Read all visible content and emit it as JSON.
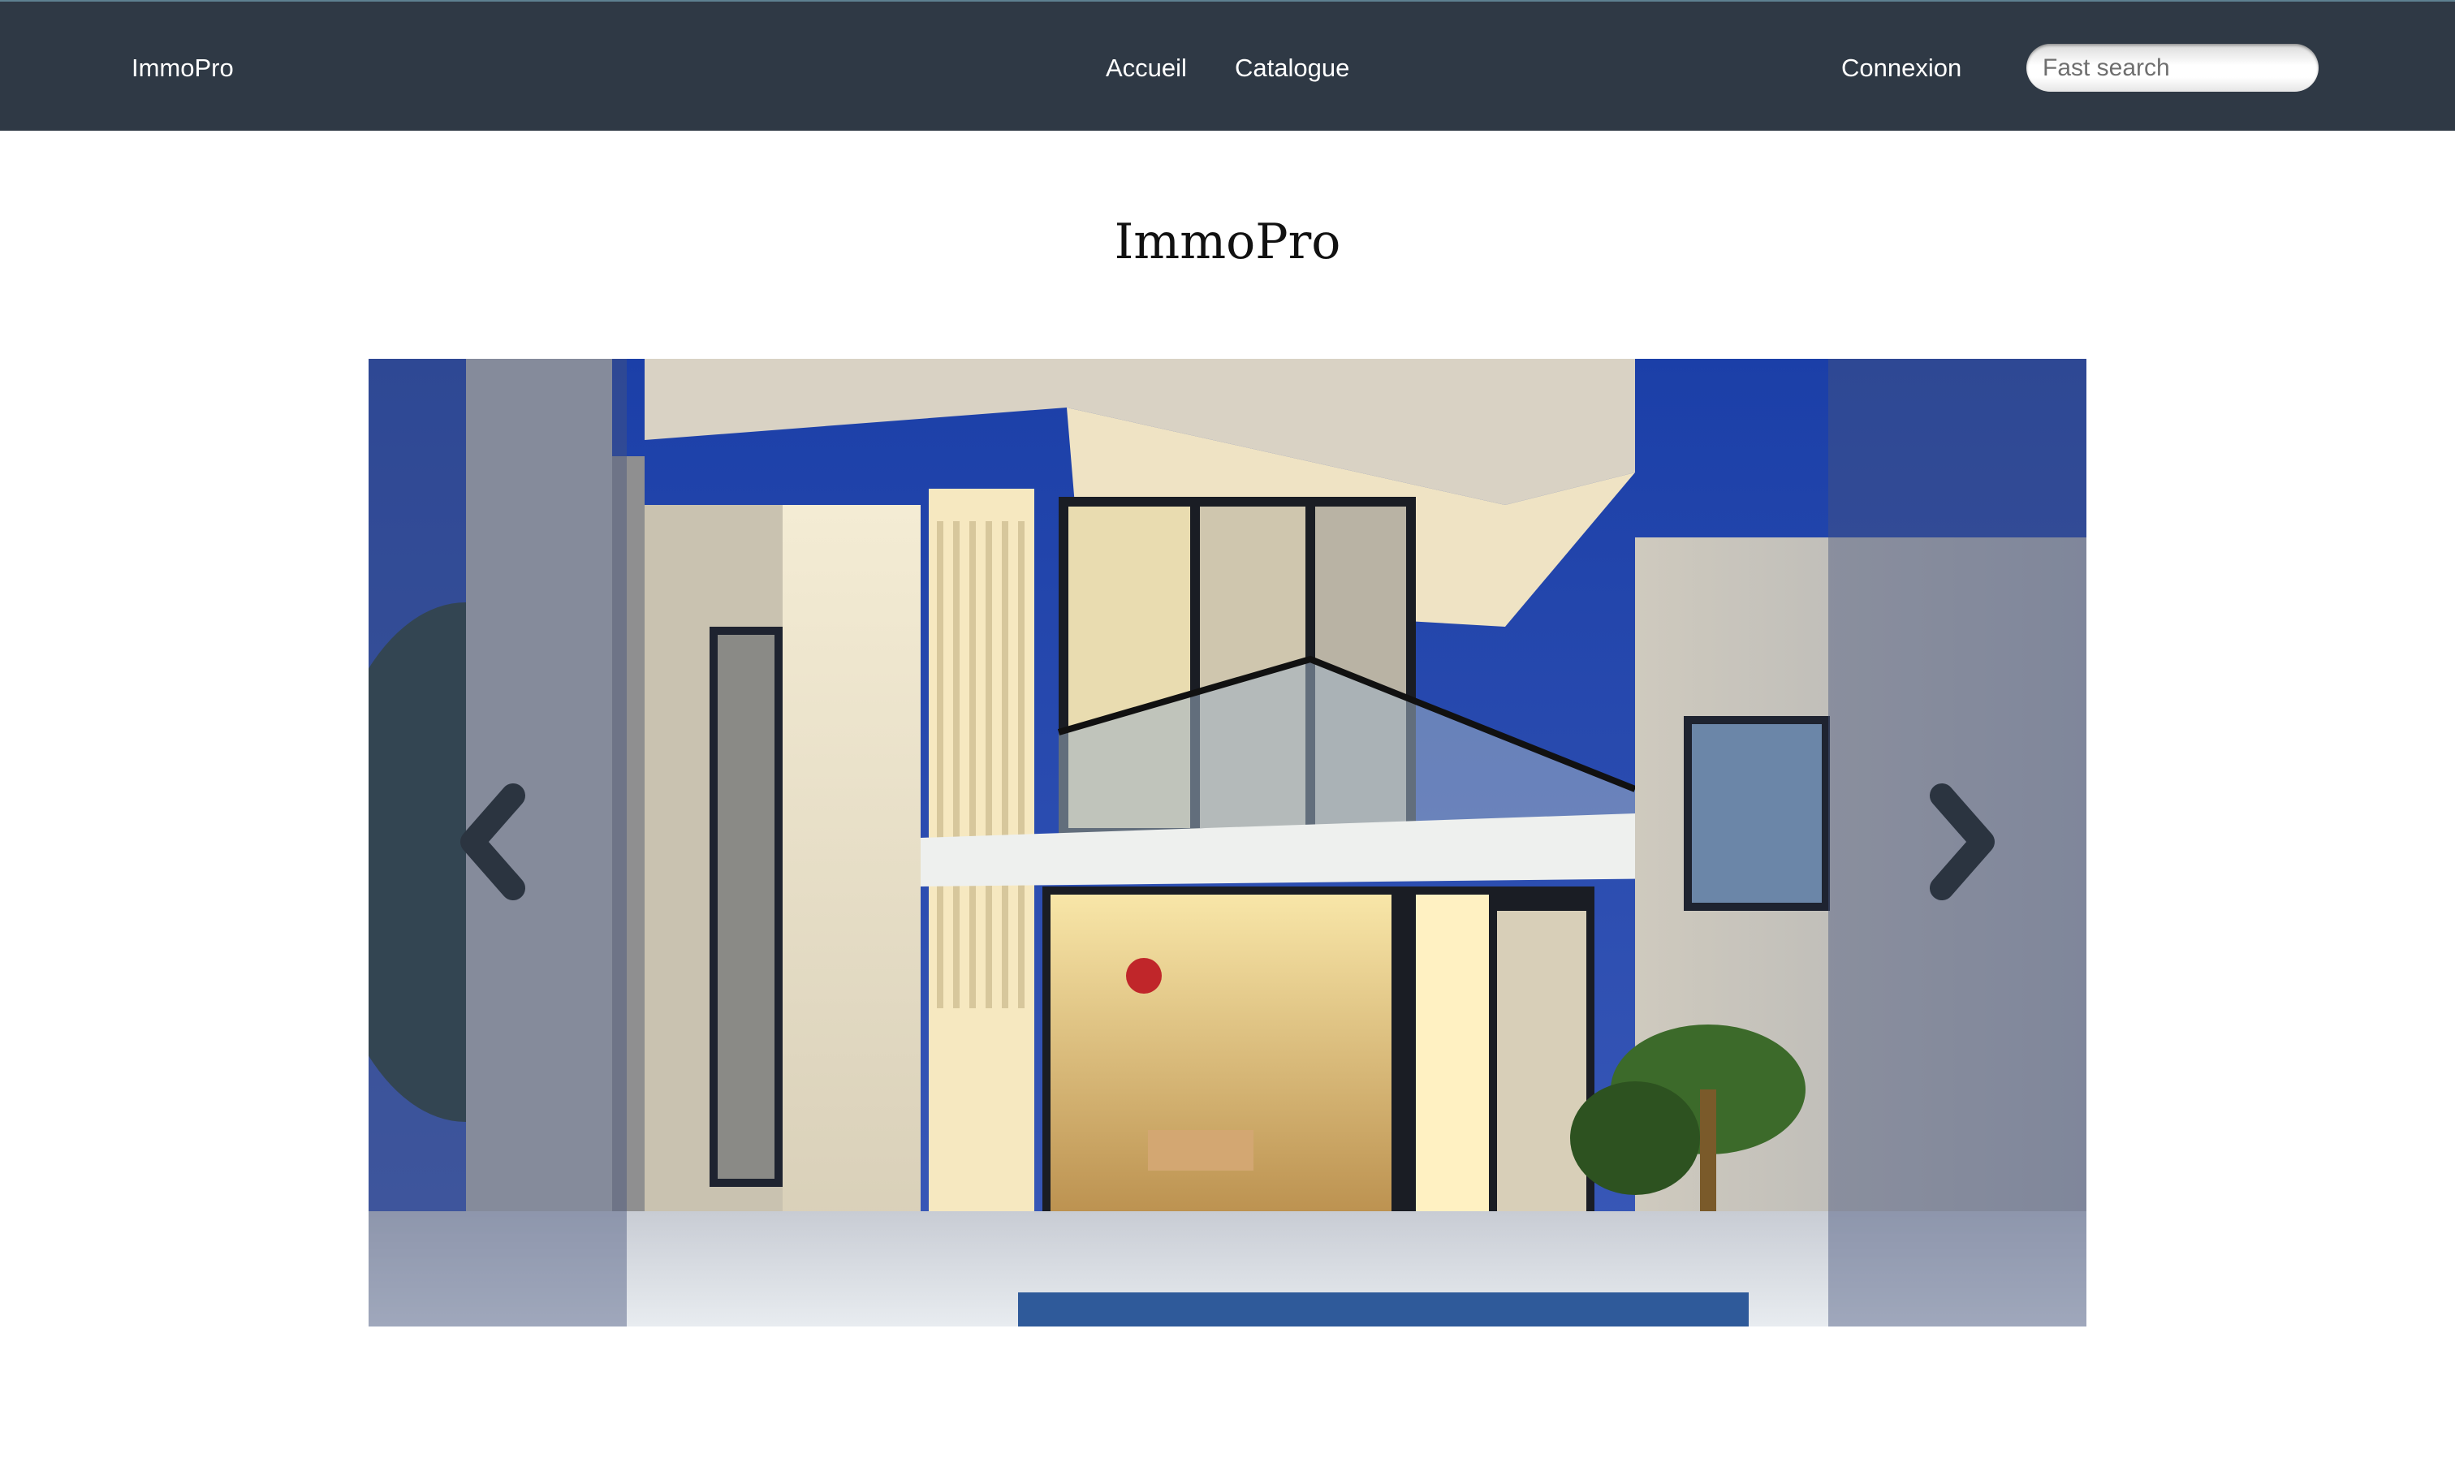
{
  "navbar": {
    "brand": "ImmoPro",
    "links": {
      "accueil": "Accueil",
      "catalogue": "Catalogue",
      "connexion": "Connexion"
    },
    "search": {
      "placeholder": "Fast search",
      "value": ""
    }
  },
  "main": {
    "title": "ImmoPro"
  },
  "carousel": {
    "prev_icon": "chevron-left-icon",
    "next_icon": "chevron-right-icon"
  },
  "colors": {
    "navbar_bg": "#2f3945",
    "navbar_text": "#ffffff",
    "arrow": "#2b3440"
  }
}
